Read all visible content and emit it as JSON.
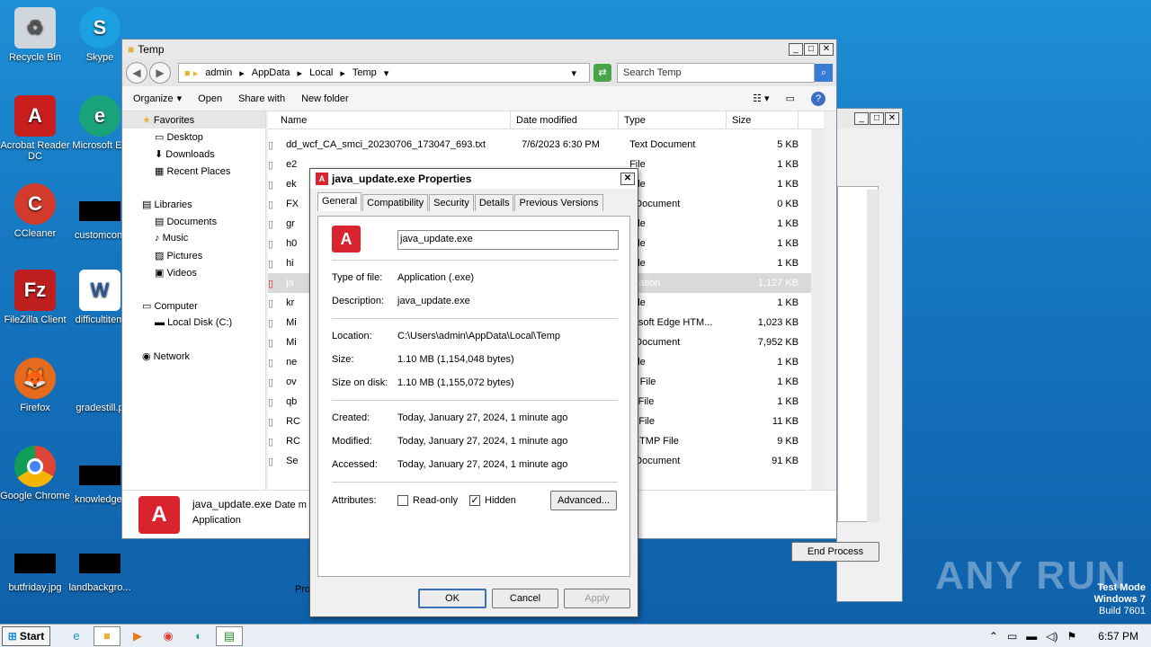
{
  "desktop": {
    "icons": [
      {
        "label": "Recycle Bin"
      },
      {
        "label": "Skype"
      },
      {
        "label": "Acrobat Reader DC"
      },
      {
        "label": "Microsoft Ed"
      },
      {
        "label": "CCleaner"
      },
      {
        "label": "customcont"
      },
      {
        "label": "FileZilla Client"
      },
      {
        "label": "difficultitem"
      },
      {
        "label": "Firefox"
      },
      {
        "label": "gradestill.p"
      },
      {
        "label": "Google Chrome"
      },
      {
        "label": "knowledge."
      },
      {
        "label": "butfriday.jpg"
      },
      {
        "label": "landbackgro..."
      }
    ]
  },
  "explorer": {
    "title": "Temp",
    "breadcrumb": [
      "admin",
      "AppData",
      "Local",
      "Temp"
    ],
    "search_placeholder": "Search Temp",
    "commands": [
      "Organize",
      "Open",
      "Share with",
      "New folder"
    ],
    "nav": {
      "favorites": "Favorites",
      "desktop": "Desktop",
      "downloads": "Downloads",
      "recent": "Recent Places",
      "libraries": "Libraries",
      "documents": "Documents",
      "music": "Music",
      "pictures": "Pictures",
      "videos": "Videos",
      "computer": "Computer",
      "localdisk": "Local Disk (C:)",
      "network": "Network"
    },
    "columns": {
      "name": "Name",
      "date": "Date modified",
      "type": "Type",
      "size": "Size"
    },
    "rows": [
      {
        "name": "dd_wcf_CA_smci_20230706_173047_693.txt",
        "date": "7/6/2023 6:30 PM",
        "type": "Text Document",
        "size": "5 KB"
      },
      {
        "name": "e2",
        "date": "",
        "type": "File",
        "size": "1 KB"
      },
      {
        "name": "ek",
        "date": "",
        "type": "File",
        "size": "1 KB"
      },
      {
        "name": "FX",
        "date": "",
        "type": "t Document",
        "size": "0 KB"
      },
      {
        "name": "gr",
        "date": "",
        "type": "File",
        "size": "1 KB"
      },
      {
        "name": "h0",
        "date": "",
        "type": "File",
        "size": "1 KB"
      },
      {
        "name": "hi",
        "date": "",
        "type": "File",
        "size": "1 KB"
      },
      {
        "name": "ja",
        "date": "",
        "type": "lication",
        "size": "1,127 KB"
      },
      {
        "name": "kr",
        "date": "",
        "type": "File",
        "size": "1 KB"
      },
      {
        "name": "Mi",
        "date": "",
        "type": "rosoft Edge HTM...",
        "size": "1,023 KB"
      },
      {
        "name": "Mi",
        "date": "",
        "type": "t Document",
        "size": "7,952 KB"
      },
      {
        "name": "ne",
        "date": "",
        "type": "File",
        "size": "1 KB"
      },
      {
        "name": "ov",
        "date": "",
        "type": "O File",
        "size": "1 KB"
      },
      {
        "name": "qb",
        "date": "",
        "type": "T File",
        "size": "1 KB"
      },
      {
        "name": "RC",
        "date": "",
        "type": "P File",
        "size": "11 KB"
      },
      {
        "name": "RC",
        "date": "",
        "type": "P-TMP File",
        "size": "9 KB"
      },
      {
        "name": "Se",
        "date": "",
        "type": "t Document",
        "size": "91 KB"
      }
    ],
    "details": {
      "name": "java_update.exe",
      "date_label": "Date m",
      "type": "Application"
    }
  },
  "dialog": {
    "title": "java_update.exe Properties",
    "tabs": [
      "General",
      "Compatibility",
      "Security",
      "Details",
      "Previous Versions"
    ],
    "filename": "java_update.exe",
    "type_label": "Type of file:",
    "type_value": "Application (.exe)",
    "desc_label": "Description:",
    "desc_value": "java_update.exe",
    "location_label": "Location:",
    "location_value": "C:\\Users\\admin\\AppData\\Local\\Temp",
    "size_label": "Size:",
    "size_value": "1.10 MB (1,154,048 bytes)",
    "sizedisk_label": "Size on disk:",
    "sizedisk_value": "1.10 MB (1,155,072 bytes)",
    "created_label": "Created:",
    "created_value": "Today, January 27, 2024, 1 minute ago",
    "modified_label": "Modified:",
    "modified_value": "Today, January 27, 2024, 1 minute ago",
    "accessed_label": "Accessed:",
    "accessed_value": "Today, January 27, 2024, 1 minute ago",
    "attributes_label": "Attributes:",
    "readonly_label": "Read-only",
    "hidden_label": "Hidden",
    "advanced_label": "Advanced...",
    "ok_label": "OK",
    "cancel_label": "Cancel",
    "apply_label": "Apply"
  },
  "taskmgr": {
    "end_process": "End Process",
    "pro_label": "Pro"
  },
  "taskbar": {
    "start_label": "Start",
    "time": "6:57 PM"
  },
  "watermark": {
    "brand": "ANY RUN",
    "mode": "Test Mode",
    "os": "Windows 7",
    "build": "Build 7601"
  },
  "colors": {
    "accent": "#d9232e",
    "selection": "#d9d9d9"
  }
}
